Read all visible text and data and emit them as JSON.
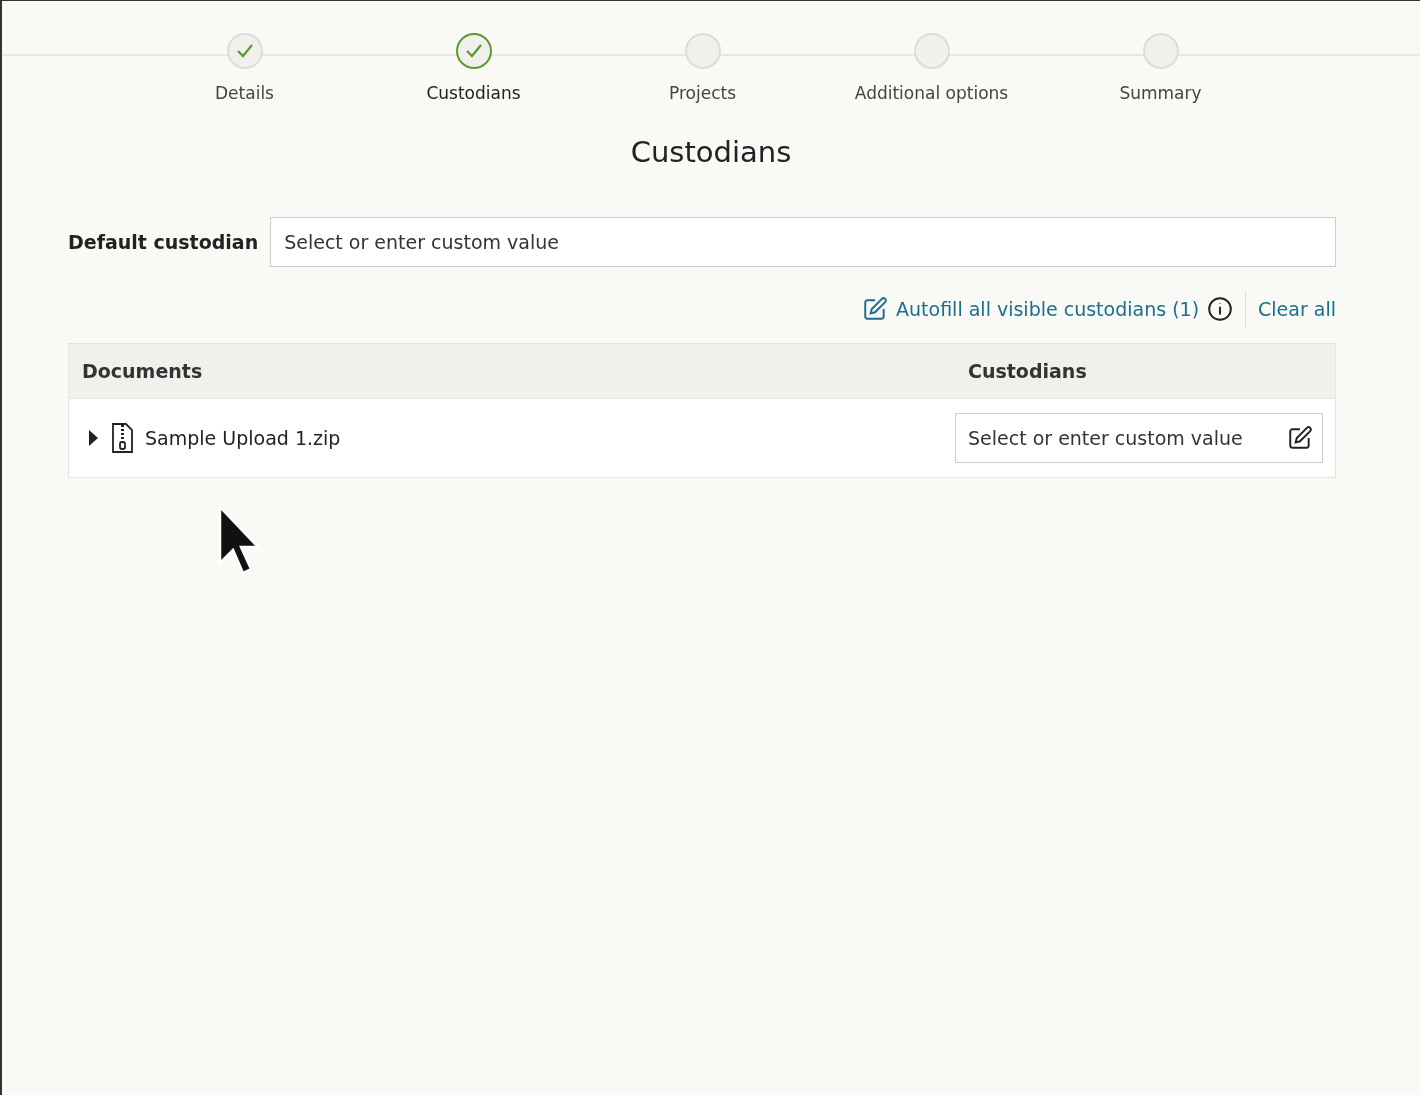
{
  "steps": [
    {
      "label": "Details",
      "completed": true,
      "selected": false
    },
    {
      "label": "Custodians",
      "completed": true,
      "selected": true
    },
    {
      "label": "Projects",
      "completed": false,
      "selected": false
    },
    {
      "label": "Additional options",
      "completed": false,
      "selected": false
    },
    {
      "label": "Summary",
      "completed": false,
      "selected": false
    }
  ],
  "heading": "Custodians",
  "default_custodian": {
    "label": "Default custodian",
    "placeholder": "Select or enter custom value"
  },
  "actions": {
    "autofill": "Autofill all visible custodians (1)",
    "clear": "Clear all"
  },
  "table": {
    "columns": [
      "Documents",
      "Custodians"
    ],
    "rows": [
      {
        "name": "Sample Upload 1.zip",
        "expanded": false,
        "custodian_placeholder": "Select or enter custom value"
      }
    ]
  }
}
